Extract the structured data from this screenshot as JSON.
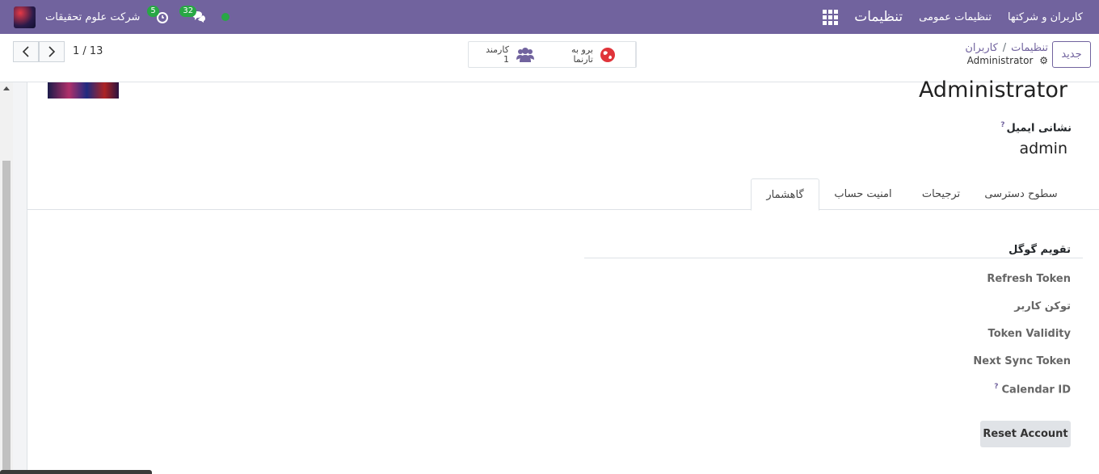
{
  "navbar": {
    "app_name": "تنظیمات",
    "menu": [
      "تنظیمات عمومی",
      "کاربران و شرکتها"
    ],
    "company": "شرکت علوم تحقیقات",
    "activity_count": "5",
    "messages_count": "32",
    "status_color": "#28a745",
    "brand_color": "#71639e"
  },
  "control": {
    "breadcrumb_parent": "تنظیمات",
    "breadcrumb_current": "کاربران",
    "breadcrumb_sep": "/",
    "record_name": "Administrator",
    "new_label": "جدید",
    "pager": "1 / 13",
    "smart_buttons": [
      {
        "label": "کارمند",
        "value": "1",
        "icon": "users-icon"
      },
      {
        "label": "برو به",
        "value": "تارنما",
        "icon": "globe-icon"
      }
    ]
  },
  "form": {
    "name": "Administrator",
    "email_label": "نشانی ایمیل",
    "email_help": "?",
    "email_value": "admin"
  },
  "tabs": [
    "سطوح دسترسی",
    "ترجیحات",
    "امنیت حساب",
    "گاهشمار"
  ],
  "active_tab": "گاهشمار",
  "google_calendar": {
    "title": "تقویم گوگل",
    "fields": [
      "Refresh Token",
      "توکن کاربر",
      "Token Validity",
      "Next Sync Token",
      "Calendar ID"
    ],
    "calendar_help": "?",
    "reset_label": "Reset Account"
  }
}
